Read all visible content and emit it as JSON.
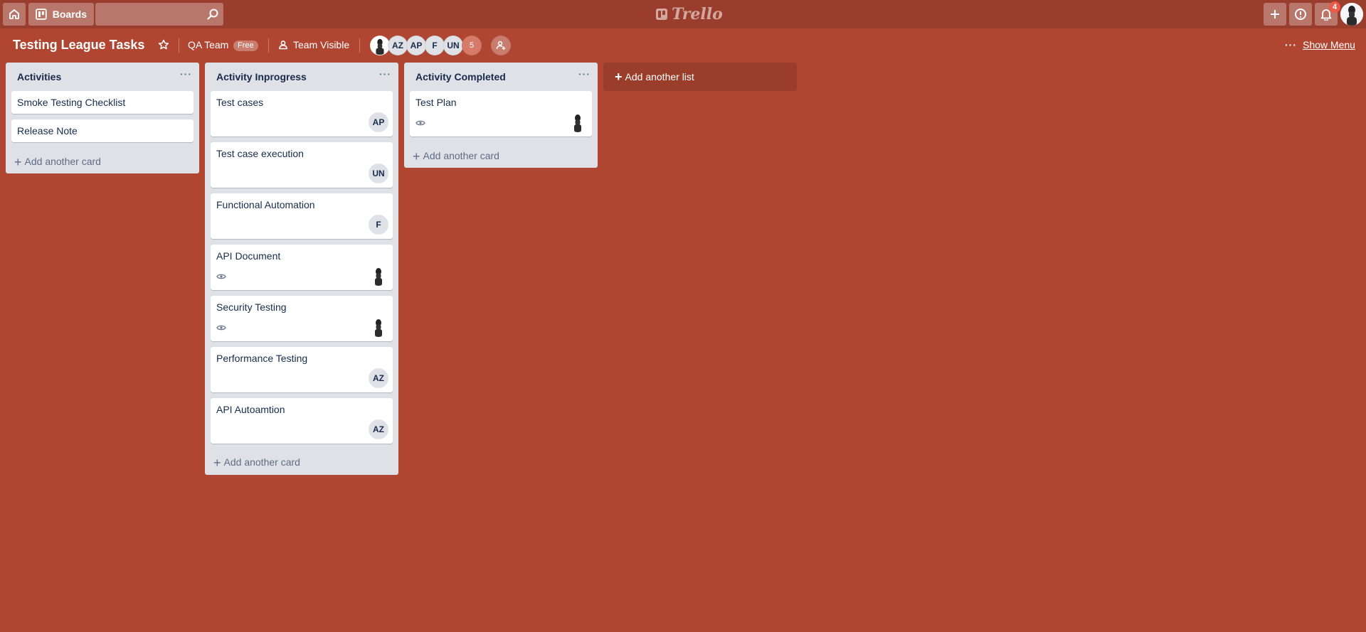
{
  "colors": {
    "board_background": "#b04632",
    "header_background": "#9b3d2c",
    "list_background": "#dfe1e6",
    "notification_badge": "#eb5a46"
  },
  "header": {
    "boards_label": "Boards",
    "search_placeholder": "",
    "logo_text": "Trello",
    "notification_count": "4",
    "icons": [
      "home-icon",
      "boards-icon",
      "search-icon",
      "plus-icon",
      "info-icon",
      "bell-icon"
    ]
  },
  "board": {
    "title": "Testing League Tasks",
    "team_name": "QA Team",
    "plan_badge": "Free",
    "visibility": "Team Visible",
    "members": [
      "AZ",
      "AP",
      "F",
      "UN"
    ],
    "more_members": "5",
    "show_menu_label": "Show Menu",
    "menu_dots": "···"
  },
  "lists": [
    {
      "title": "Activities",
      "menu": "···",
      "cards": [
        {
          "title": "Smoke Testing Checklist"
        },
        {
          "title": "Release Note"
        }
      ],
      "add_card_label": "Add another card"
    },
    {
      "title": "Activity Inprogress",
      "menu": "···",
      "cards": [
        {
          "title": "Test cases",
          "member": "AP"
        },
        {
          "title": "Test case execution",
          "member": "UN"
        },
        {
          "title": "Functional Automation",
          "member": "F"
        },
        {
          "title": "API Document",
          "watching": true,
          "member_photo": true
        },
        {
          "title": "Security Testing",
          "watching": true,
          "member_photo": true
        },
        {
          "title": "Performance Testing",
          "member": "AZ"
        },
        {
          "title": "API Autoamtion",
          "member": "AZ"
        }
      ],
      "add_card_label": "Add another card"
    },
    {
      "title": "Activity Completed",
      "menu": "···",
      "cards": [
        {
          "title": "Test Plan",
          "watching": true,
          "member_photo": true
        }
      ],
      "add_card_label": "Add another card"
    }
  ],
  "add_list_label": "Add another list"
}
